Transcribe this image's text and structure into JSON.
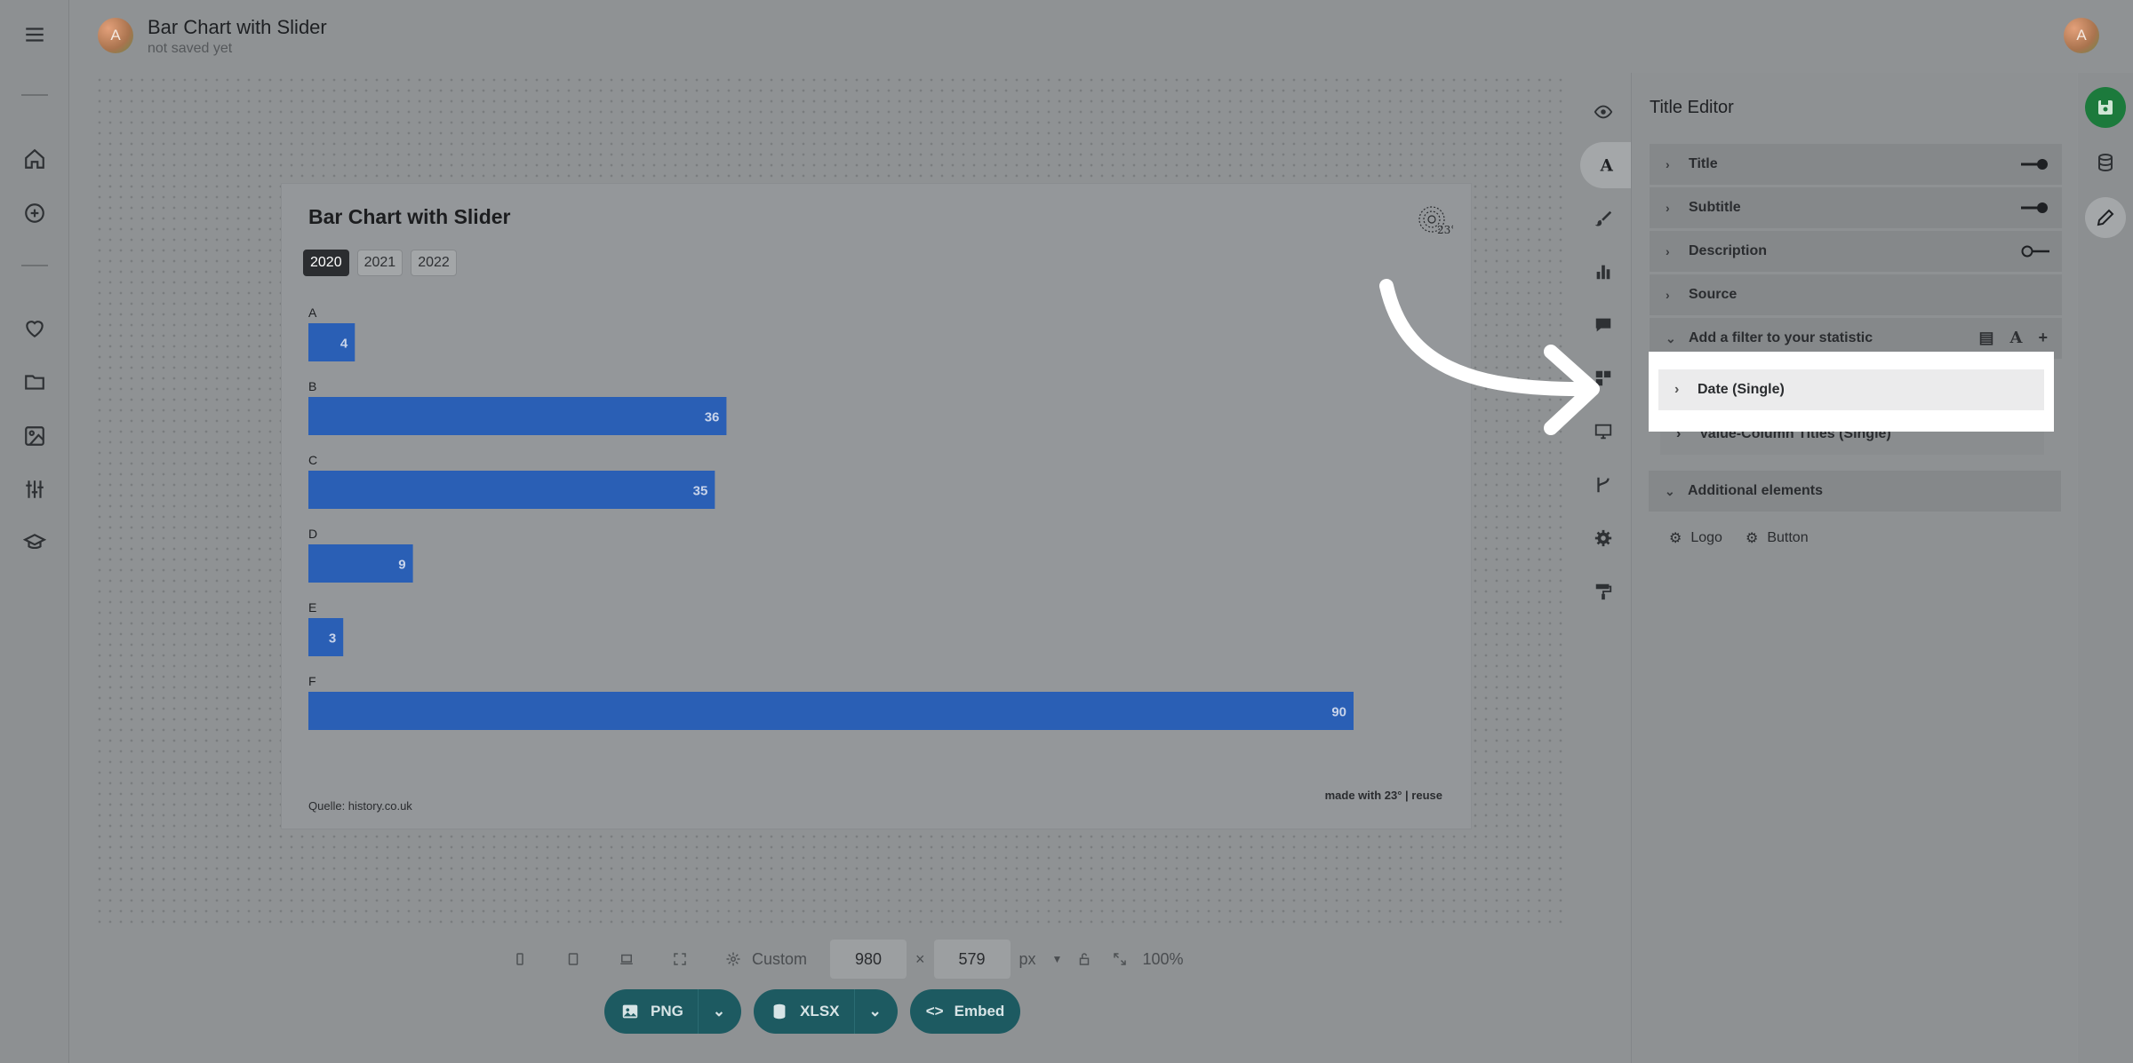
{
  "header": {
    "avatar_letter": "A",
    "title": "Bar Chart with Slider",
    "subtitle": "not saved yet",
    "user_avatar_letter": "A"
  },
  "left_nav": {
    "icons": [
      "menu-icon",
      "home-icon",
      "add-icon",
      "heart-icon",
      "folder-icon",
      "image-icon",
      "sliders-icon",
      "graduation-cap-icon"
    ]
  },
  "chart": {
    "year_tabs": [
      "2020",
      "2021",
      "2022"
    ],
    "active_year": "2020",
    "source_text": "Quelle: history.co.uk",
    "made_with_text": "made with 23° | reuse"
  },
  "chart_data": {
    "type": "bar",
    "orientation": "horizontal",
    "title": "Bar Chart with Slider",
    "categories": [
      "A",
      "B",
      "C",
      "D",
      "E",
      "F"
    ],
    "values": [
      4,
      36,
      35,
      9,
      3,
      90
    ],
    "bar_color": "#2a5fb5",
    "value_labels": true,
    "xlim": [
      0,
      90
    ],
    "grid": false
  },
  "size_bar": {
    "preset": "Custom",
    "width": "980",
    "height": "579",
    "unit": "px",
    "zoom": "100%",
    "times": "×"
  },
  "export": {
    "png": "PNG",
    "xlsx": "XLSX",
    "embed": "Embed",
    "accent": "#1d5a61"
  },
  "tool_strip": {
    "icons": [
      "eye-icon",
      "text-icon",
      "brush-icon",
      "bar-chart-icon",
      "comment-icon",
      "layout-icon",
      "screen-icon",
      "branch-icon",
      "gear-icon",
      "paint-roller-icon"
    ],
    "active": "text-icon"
  },
  "panel": {
    "title": "Title Editor",
    "rows": [
      {
        "label": "Title",
        "toggle": "on"
      },
      {
        "label": "Subtitle",
        "toggle": "on"
      },
      {
        "label": "Description",
        "toggle": "off"
      },
      {
        "label": "Source"
      }
    ],
    "filter_section": "Add a filter to your statistic",
    "filters": [
      "Date (Single)",
      "Value-Column Titles (Single)"
    ],
    "additional_section": "Additional elements",
    "additional_items": [
      "Logo",
      "Button"
    ]
  },
  "right_rail": {
    "icons": [
      "save-icon",
      "database-icon",
      "pencil-icon"
    ],
    "save_color": "#1c7a3c"
  }
}
